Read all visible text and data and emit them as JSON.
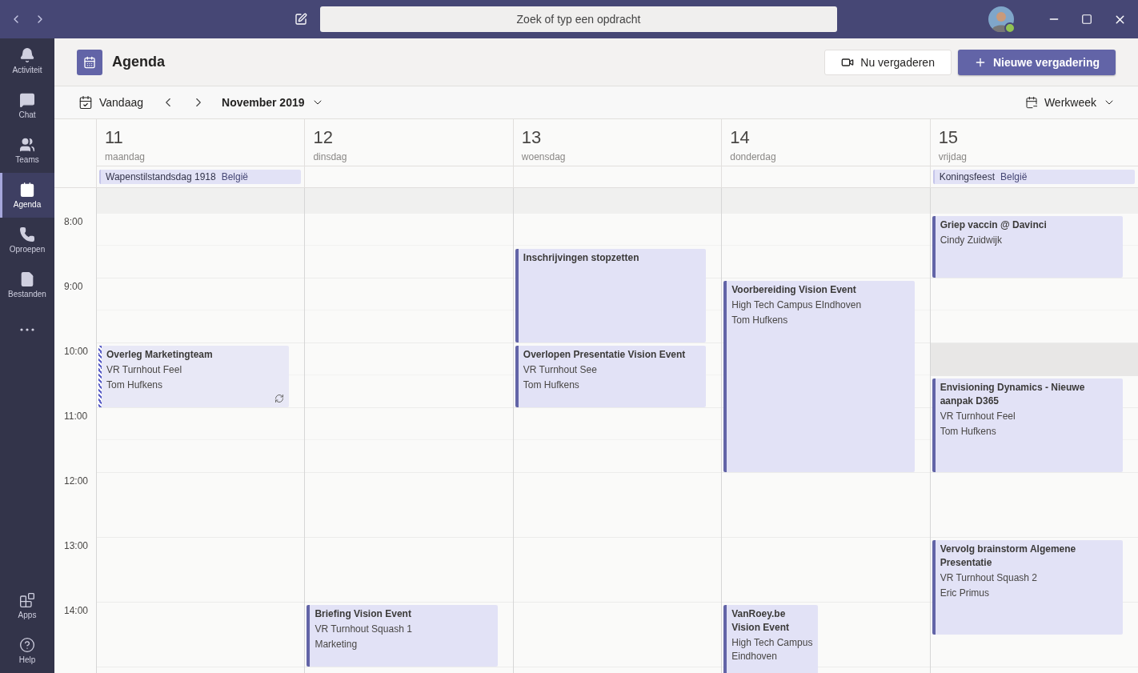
{
  "titlebar": {
    "search": {
      "placeholder": "Zoek of typ een opdracht"
    }
  },
  "sidebar": {
    "items": [
      {
        "label": "Activiteit",
        "selected": false
      },
      {
        "label": "Chat",
        "selected": false
      },
      {
        "label": "Teams",
        "selected": false
      },
      {
        "label": "Agenda",
        "selected": true
      },
      {
        "label": "Oproepen",
        "selected": false
      },
      {
        "label": "Bestanden",
        "selected": false
      }
    ],
    "bottom_items": [
      {
        "label": "Apps",
        "selected": false
      },
      {
        "label": "Help",
        "selected": false
      }
    ]
  },
  "header": {
    "title": "Agenda",
    "buttons": [
      {
        "label": "Nu vergaderen",
        "kind": "secondary"
      },
      {
        "label": "Nieuwe vergadering",
        "kind": "primary"
      }
    ]
  },
  "toolbar": {
    "today": "Vandaag",
    "month": "November 2019",
    "view": "Werkweek"
  },
  "days": [
    {
      "number": "11",
      "weekday": "maandag",
      "holiday": {
        "name": "Wapenstilstandsdag 1918",
        "country": "België"
      }
    },
    {
      "number": "12",
      "weekday": "dinsdag"
    },
    {
      "number": "13",
      "weekday": "woensdag"
    },
    {
      "number": "14",
      "weekday": "donderdag"
    },
    {
      "number": "15",
      "weekday": "vrijdag",
      "holiday": {
        "name": "Koningsfeest",
        "country": "België"
      }
    }
  ],
  "hours": [
    "8:00",
    "9:00",
    "10:00",
    "11:00",
    "12:00",
    "13:00",
    "14:00"
  ],
  "events": [
    {
      "title": "Overleg Marketingteam",
      "lines": [
        "VR Turnhout Feel",
        "Tom Hufkens"
      ],
      "tentative": true,
      "recurring": true
    },
    {
      "title": "Inschrijvingen stopzetten",
      "tentative": false,
      "recurring": false
    },
    {
      "title": "Overlopen Presentatie Vision Event",
      "lines": [
        "VR Turnhout See",
        "Tom Hufkens"
      ],
      "tentative": false,
      "recurring": false
    },
    {
      "title": "Voorbereiding Vision Event",
      "lines": [
        "High Tech Campus EIndhoven",
        "Tom Hufkens"
      ],
      "tentative": false,
      "recurring": false
    },
    {
      "title": "Griep vaccin @ Davinci",
      "lines": [
        "Cindy Zuidwijk"
      ],
      "tentative": false,
      "recurring": false
    },
    {
      "title": "Envisioning Dynamics - Nieuwe aanpak D365",
      "lines": [
        "VR Turnhout Feel",
        "Tom Hufkens"
      ],
      "tentative": false,
      "recurring": false
    },
    {
      "title": "Vervolg brainstorm Algemene Presentatie",
      "lines": [
        "VR Turnhout Squash 2",
        "Eric Primus"
      ],
      "tentative": false,
      "recurring": false
    },
    {
      "title": "Briefing Vision Event",
      "lines": [
        "VR Turnhout Squash 1",
        "Marketing"
      ],
      "tentative": false,
      "recurring": false
    },
    {
      "title": "VanRoey.be Vision Event",
      "lines": [
        "High Tech Campus Eindhoven"
      ],
      "tentative": false,
      "recurring": false
    }
  ]
}
